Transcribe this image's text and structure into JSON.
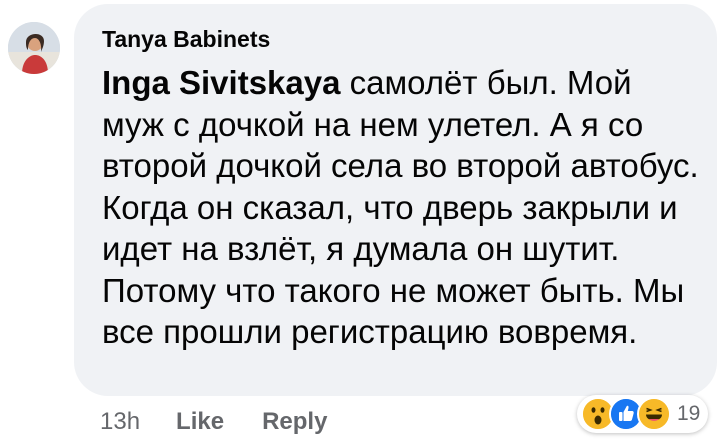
{
  "comment": {
    "author_name": "Tanya Babinets",
    "mention_name": "Inga Sivitskaya",
    "text": " самолёт был. Мой муж с дочкой на нем улетел. А я со второй дочкой села во второй автобус. Когда он сказал, что дверь закрыли и идет на взлёт, я думала он шутит. Потому что такого не может быть. Мы все прошли регистрацию вовремя."
  },
  "meta": {
    "time": "13h",
    "like_label": "Like",
    "reply_label": "Reply"
  },
  "reactions": {
    "icons": [
      "wow-reaction-icon",
      "like-reaction-icon",
      "haha-reaction-icon"
    ],
    "count": "19"
  },
  "colors": {
    "bubble_bg": "#f0f2f5",
    "text": "#050505",
    "meta_text": "#65676b",
    "like_blue": "#1877f2",
    "reaction_yellow": "#f7b928"
  }
}
